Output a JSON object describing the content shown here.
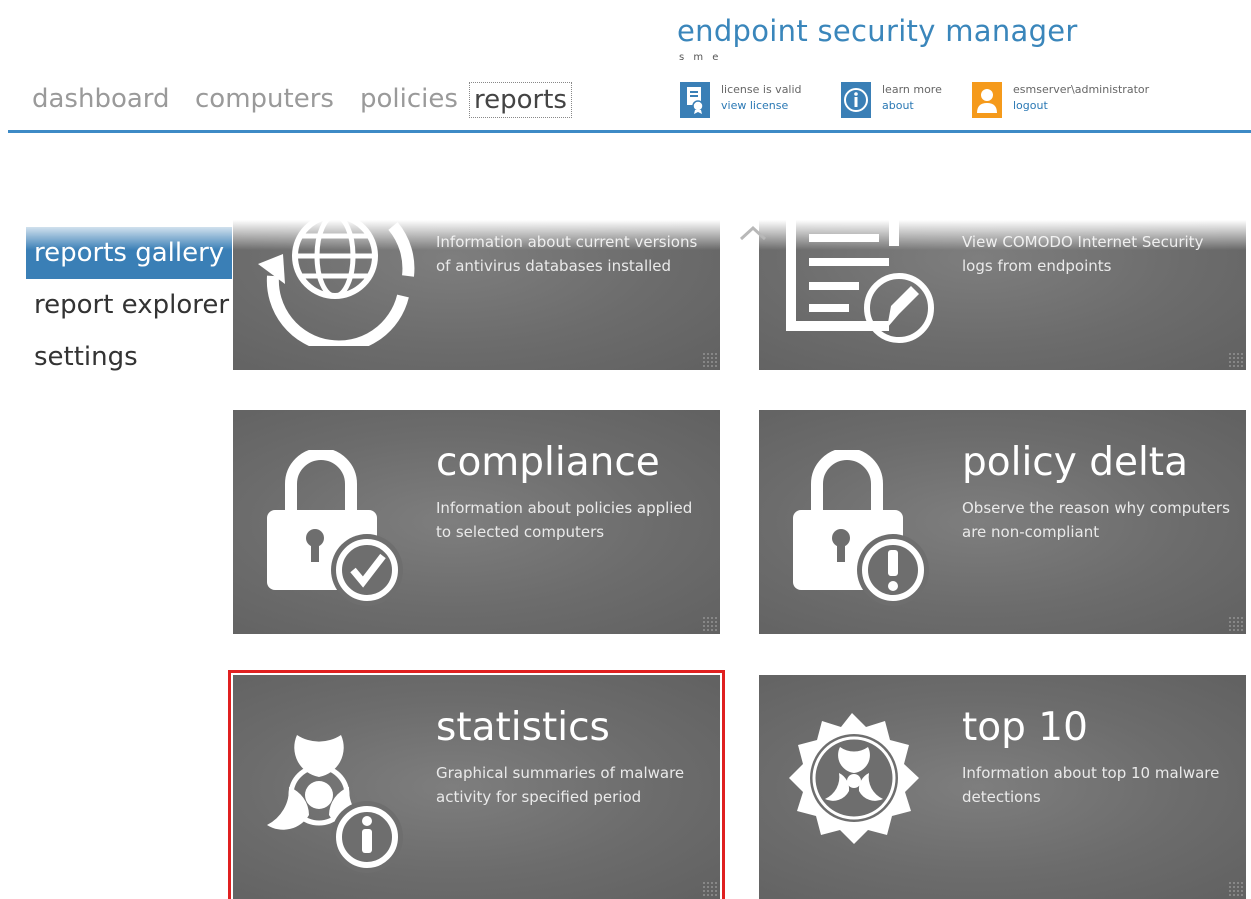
{
  "app": {
    "title": "endpoint security manager",
    "edition": "s m e"
  },
  "nav": {
    "items": [
      {
        "label": "dashboard",
        "active": false
      },
      {
        "label": "computers",
        "active": false
      },
      {
        "label": "policies",
        "active": false
      },
      {
        "label": "reports",
        "active": true
      }
    ]
  },
  "header": {
    "license": {
      "status": "license is valid",
      "link": "view license",
      "icon": "license-icon"
    },
    "learn": {
      "status": "learn more",
      "link": "about",
      "icon": "info-icon"
    },
    "user": {
      "name": "esmserver\\administrator",
      "link": "logout",
      "icon": "user-icon"
    }
  },
  "sidebar": {
    "items": [
      {
        "label": "reports gallery",
        "active": true
      },
      {
        "label": "report explorer",
        "active": false
      },
      {
        "label": "settings",
        "active": false
      }
    ]
  },
  "tiles": [
    {
      "title": "",
      "description": "Information about current versions of antivirus databases installed",
      "icon": "globe-refresh-icon"
    },
    {
      "title": "",
      "description": "View COMODO Internet Security logs from endpoints",
      "icon": "log-document-icon"
    },
    {
      "title": "compliance",
      "description": "Information about policies applied to selected computers",
      "icon": "lock-check-icon"
    },
    {
      "title": "policy delta",
      "description": "Observe the reason why computers are non-compliant",
      "icon": "lock-warning-icon"
    },
    {
      "title": "statistics",
      "description": "Graphical summaries of malware activity for specified period",
      "icon": "biohazard-info-icon",
      "selected": true
    },
    {
      "title": "top 10",
      "description": "Information about top 10 malware detections",
      "icon": "biohazard-badge-icon"
    }
  ],
  "colors": {
    "accent": "#3a7fb6",
    "tile": "#6e6e6e",
    "selection": "#e02020",
    "user": "#f59a1b"
  }
}
